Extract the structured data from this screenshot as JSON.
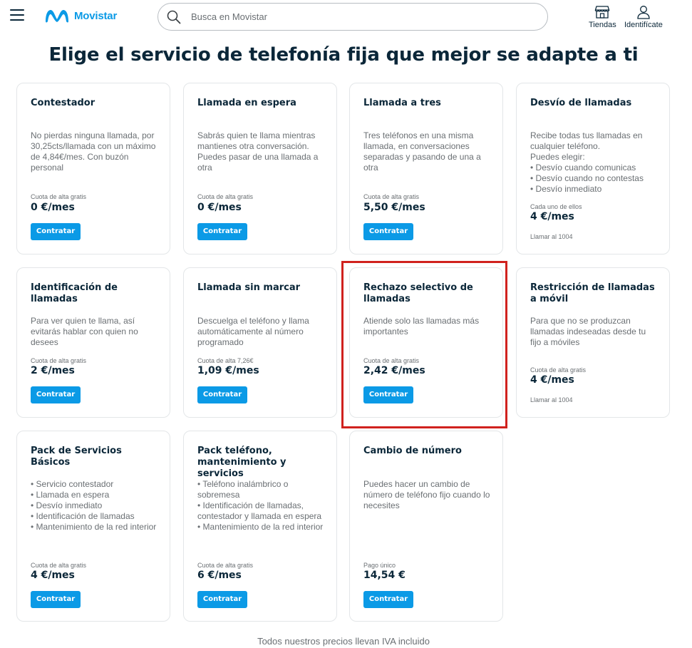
{
  "header": {
    "logo_text": "Movistar",
    "search_placeholder": "Busca en Movistar",
    "stores_label": "Tiendas",
    "login_label": "Identifícate",
    "brand_color": "#0b9ae6"
  },
  "page": {
    "title": "Elige el servicio de telefonía fija que mejor se adapte a ti",
    "footer": "Todos nuestros precios llevan IVA incluido"
  },
  "cards": [
    {
      "title": "Contestador",
      "desc": "No pierdas ninguna llamada, por 30,25cts/llamada con un máximo de 4,84€/mes. Con buzón personal",
      "note": "Cuota de alta gratis",
      "price": "0 €/mes",
      "button": "Contratar",
      "extra": ""
    },
    {
      "title": "Llamada en espera",
      "desc": "Sabrás quien te llama mientras mantienes otra conversación. Puedes pasar de una llamada a otra",
      "note": "Cuota de alta gratis",
      "price": "0 €/mes",
      "button": "Contratar",
      "extra": ""
    },
    {
      "title": "Llamada a tres",
      "desc": "Tres teléfonos en una misma llamada, en conversaciones separadas y pasando de una a otra",
      "note": "Cuota de alta gratis",
      "price": "5,50 €/mes",
      "button": "Contratar",
      "extra": ""
    },
    {
      "title": "Desvío de llamadas",
      "desc": "Recibe todas tus llamadas en cualquier teléfono.\nPuedes elegir:\n• Desvío cuando comunicas\n• Desvío cuando no contestas\n• Desvío inmediato",
      "note": "Cada uno de ellos",
      "price": "4 €/mes",
      "button": "",
      "extra": "Llamar al 1004"
    },
    {
      "title": "Identificación de llamadas",
      "desc": "Para ver quien te llama, así evitarás hablar con quien no desees",
      "note": "Cuota de alta gratis",
      "price": "2 €/mes",
      "button": "Contratar",
      "extra": ""
    },
    {
      "title": "Llamada sin marcar",
      "desc": "Descuelga el teléfono y llama automáticamente al número programado",
      "note": "Cuota de alta 7,26€",
      "price": "1,09 €/mes",
      "button": "Contratar",
      "extra": ""
    },
    {
      "title": "Rechazo selectivo de llamadas",
      "desc": "Atiende solo las llamadas más importantes",
      "note": "Cuota de alta gratis",
      "price": "2,42 €/mes",
      "button": "Contratar",
      "extra": ""
    },
    {
      "title": "Restricción de llamadas a móvil",
      "desc": "Para que no se produzcan llamadas indeseadas desde tu fijo a móviles",
      "note": "Cuota de alta gratis",
      "price": "4 €/mes",
      "button": "",
      "extra": "Llamar al 1004"
    },
    {
      "title": "Pack de Servicios Básicos",
      "desc": "• Servicio contestador\n• Llamada en espera\n• Desvío inmediato\n• Identificación de llamadas\n• Mantenimiento de la red interior",
      "note": "Cuota de alta gratis",
      "price": "4 €/mes",
      "button": "Contratar",
      "extra": ""
    },
    {
      "title": "Pack teléfono, mantenimiento y servicios",
      "desc": "• Teléfono inalámbrico o sobremesa\n• Identificación de llamadas, contestador y llamada en espera\n• Mantenimiento de la red interior",
      "note": "Cuota de alta gratis",
      "price": "6 €/mes",
      "button": "Contratar",
      "extra": ""
    },
    {
      "title": "Cambio de número",
      "desc": "Puedes hacer un cambio de número de teléfono fijo cuando lo necesites",
      "note": "Pago único",
      "price": "14,54 €",
      "button": "Contratar",
      "extra": ""
    }
  ]
}
